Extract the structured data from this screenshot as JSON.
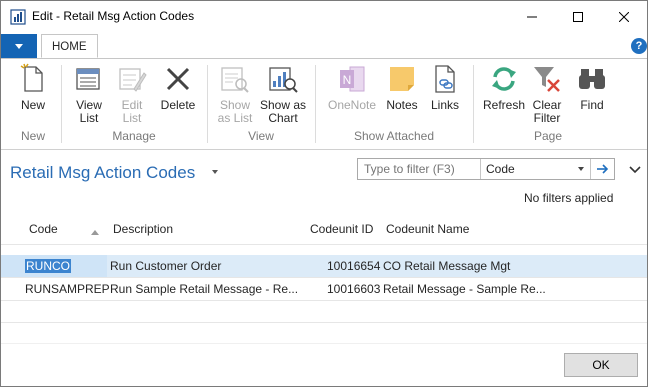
{
  "window": {
    "title": "Edit - Retail Msg Action Codes"
  },
  "tabs": {
    "home": "HOME"
  },
  "ribbon": {
    "new": "New",
    "view_list": [
      "View",
      "List"
    ],
    "edit_list": [
      "Edit",
      "List"
    ],
    "delete": "Delete",
    "show_as_list": [
      "Show",
      "as List"
    ],
    "show_as_chart": [
      "Show as",
      "Chart"
    ],
    "onenote": "OneNote",
    "notes": "Notes",
    "links": "Links",
    "refresh": "Refresh",
    "clear_filter": [
      "Clear",
      "Filter"
    ],
    "find": "Find",
    "groups": {
      "new": "New",
      "manage": "Manage",
      "view": "View",
      "show_attached": "Show Attached",
      "page": "Page"
    }
  },
  "page": {
    "title": "Retail Msg Action Codes",
    "filter_placeholder": "Type to filter (F3)",
    "filter_field": "Code",
    "filter_status": "No filters applied"
  },
  "grid": {
    "columns": [
      "Code",
      "Description",
      "Codeunit ID",
      "Codeunit Name"
    ],
    "rows": [
      {
        "code": "RUNCO",
        "description": "Run Customer Order",
        "codeunit_id": "10016654",
        "codeunit_name": "CO Retail Message Mgt"
      },
      {
        "code": "RUNSAMPREP",
        "description": "Run Sample Retail Message - Re...",
        "codeunit_id": "10016603",
        "codeunit_name": "Retail Message - Sample Re..."
      }
    ]
  },
  "footer": {
    "ok": "OK"
  },
  "colors": {
    "accent": "#2a6cb4",
    "selection": "#cfe4f7",
    "app_menu": "#1464b4"
  }
}
